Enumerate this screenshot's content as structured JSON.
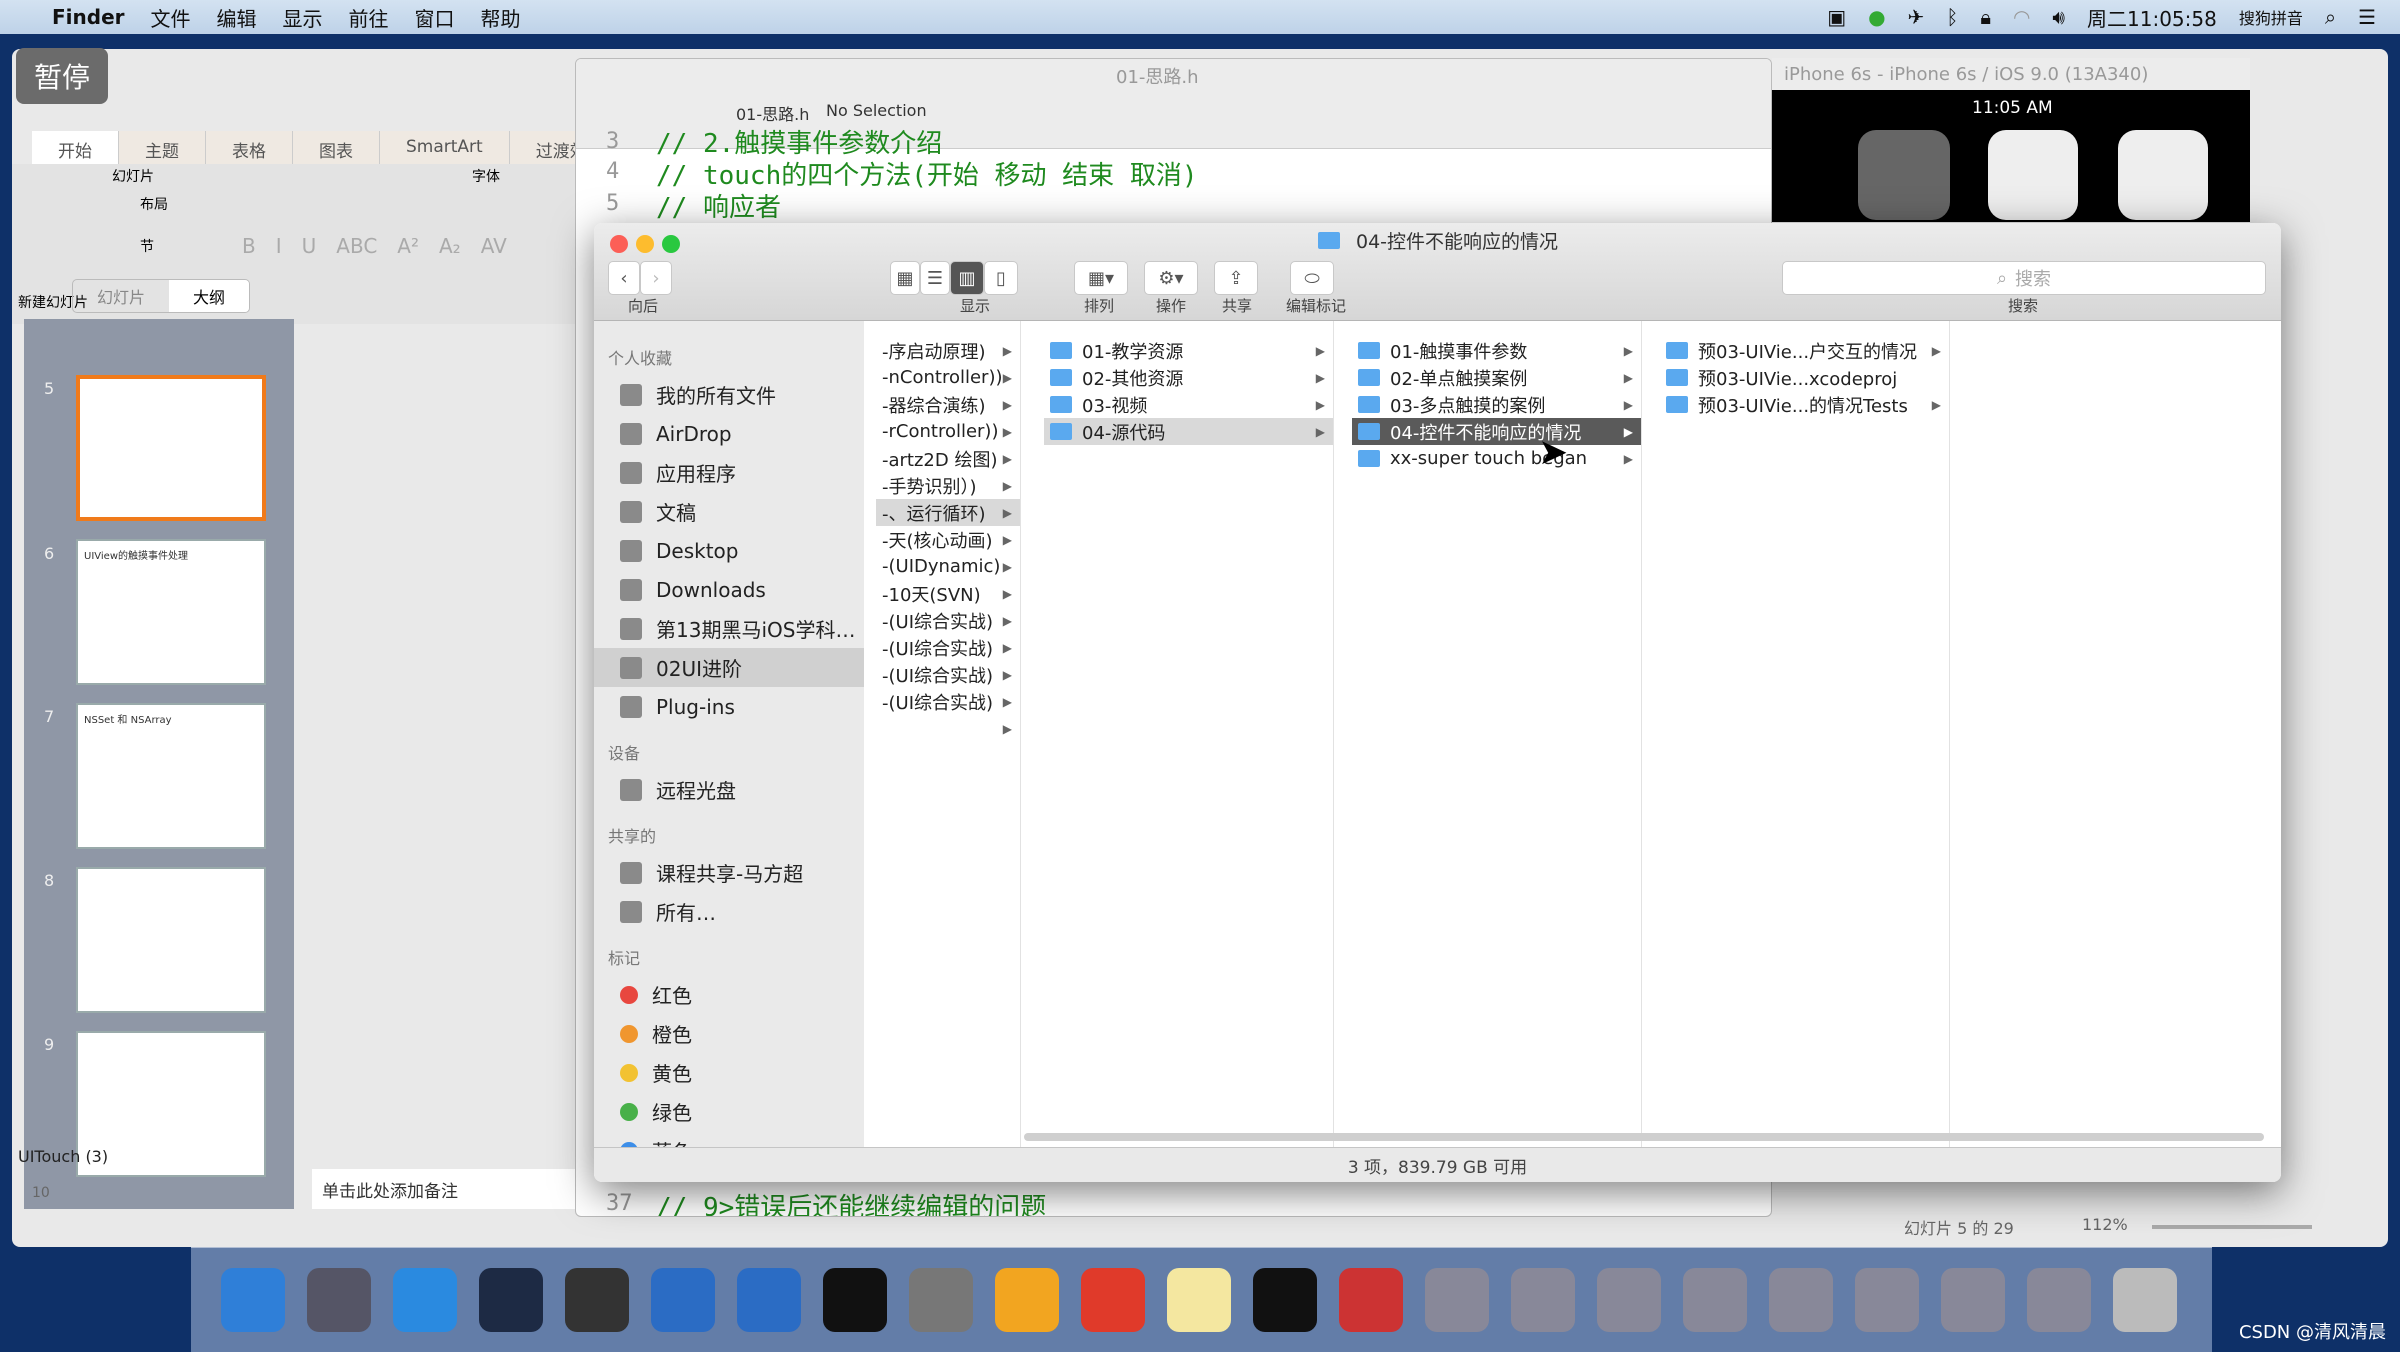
{
  "menubar": {
    "app": "Finder",
    "items": [
      "文件",
      "编辑",
      "显示",
      "前往",
      "窗口",
      "帮助"
    ],
    "clock": "周二11:05:58",
    "ime": "搜狗拼音"
  },
  "overlay": {
    "pause": "暂停"
  },
  "powerpoint": {
    "tabs": [
      "开始",
      "主题",
      "表格",
      "图表",
      "SmartArt",
      "过渡效果"
    ],
    "groups": {
      "slides": "幻灯片",
      "font": "字体"
    },
    "new_slide": "新建幻灯片",
    "layout": "布局",
    "section": "节",
    "format_buttons": [
      "B",
      "I",
      "U",
      "ABC",
      "A²",
      "A₂",
      "AV"
    ],
    "pane_tabs": [
      "幻灯片",
      "大纲"
    ],
    "slides": [
      {
        "num": "5",
        "title": ""
      },
      {
        "num": "6",
        "title": "UIView的触摸事件处理"
      },
      {
        "num": "7",
        "title": "NSSet 和 NSArray"
      },
      {
        "num": "8",
        "title": ""
      },
      {
        "num": "9",
        "title": ""
      }
    ],
    "section_label": "UITouch (3)",
    "next_num": "10",
    "notes_placeholder": "单击此处添加备注",
    "status": "幻灯片 5 的 29",
    "zoom": "112%"
  },
  "xcode": {
    "title": "01-思路.h",
    "breadcrumb": [
      "01-思路.h",
      "No Selection"
    ],
    "lines": [
      {
        "n": "3",
        "t": "// 2.触摸事件参数介绍"
      },
      {
        "n": "4",
        "t": "// touch的四个方法(开始 移动 结束 取消)"
      },
      {
        "n": "5",
        "t": "// 响应者"
      },
      {
        "n": "37",
        "t": "// 9>错误后还能继续编辑的问题"
      }
    ]
  },
  "simulator": {
    "title": "iPhone 6s - iPhone 6s / iOS 9.0 (13A340)",
    "time": "11:05 AM"
  },
  "finder": {
    "title": "04-控件不能响应的情况",
    "toolbar": {
      "back": "向后",
      "view": "显示",
      "arrange": "排列",
      "action": "操作",
      "share": "共享",
      "tags": "编辑标记",
      "search_placeholder": "搜索",
      "search_label": "搜索"
    },
    "sidebar": [
      {
        "heading": "个人收藏",
        "items": [
          "我的所有文件",
          "AirDrop",
          "应用程序",
          "文稿",
          "Desktop",
          "Downloads",
          "第13期黑马iOS学科…",
          "02UI进阶",
          "Plug-ins"
        ]
      },
      {
        "heading": "设备",
        "items": [
          "远程光盘"
        ]
      },
      {
        "heading": "共享的",
        "items": [
          "课程共享-马方超",
          "所有…"
        ]
      },
      {
        "heading": "标记",
        "items": [
          "红色",
          "橙色",
          "黄色",
          "绿色",
          "蓝色"
        ]
      }
    ],
    "tag_colors": [
      "#e8473f",
      "#f0962f",
      "#f2c232",
      "#48b049",
      "#3d8ee8"
    ],
    "selected_sidebar": "02UI进阶",
    "columns": [
      [
        "-序启动原理)",
        "-nController))",
        "-器综合演练)",
        "-rController))",
        "-artz2D 绘图)",
        "-手势识别）)",
        "-、运行循环)",
        "-天(核心动画)",
        "-(UIDynamic)",
        "-10天(SVN)",
        "-(UI综合实战)",
        "-(UI综合实战)",
        "-(UI综合实战)",
        "-(UI综合实战)",
        ""
      ],
      [
        "01-教学资源",
        "02-其他资源",
        "03-视频",
        "04-源代码"
      ],
      [
        "01-触摸事件参数",
        "02-单点触摸案例",
        "03-多点触摸的案例",
        "04-控件不能响应的情况",
        "xx-super touch began"
      ],
      [
        "预03-UIVie...户交互的情况",
        "预03-UIVie...xcodeproj",
        "预03-UIVie...的情况Tests"
      ]
    ],
    "status": "3 项，839.79 GB 可用"
  },
  "dock": [
    "finder",
    "launchpad",
    "safari",
    "mouse",
    "imovie",
    "xcode",
    "instruments",
    "terminal",
    "system-preferences",
    "sketch",
    "powerpoint",
    "notes",
    "exec",
    "screen-recorder",
    "window",
    "window",
    "window",
    "window",
    "window",
    "window",
    "window",
    "window",
    "trash"
  ],
  "watermark": "CSDN @清风清晨"
}
